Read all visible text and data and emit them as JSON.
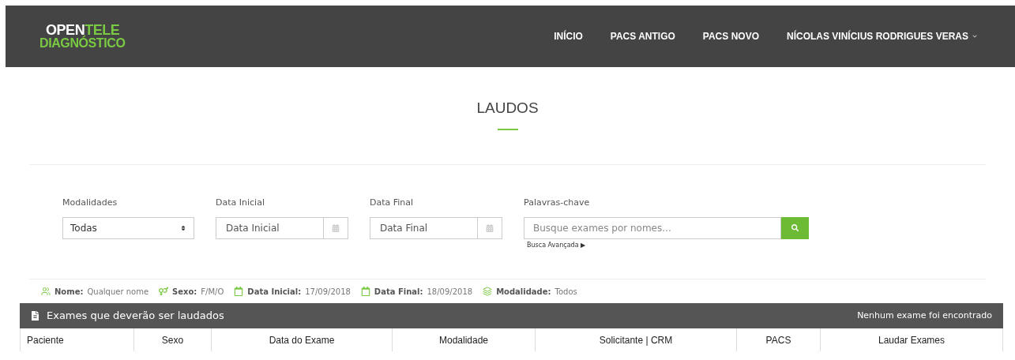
{
  "logo": {
    "line_1_white": "OPEN",
    "line_1_green": "TELE",
    "line_2": "DIAGNÓSTICO"
  },
  "nav": [
    "INÍCIO",
    "PACS ANTIGO",
    "PACS NOVO"
  ],
  "user_menu": "NÍCOLAS VINÍCIUS RODRIGUES VERAS",
  "page_title": "LAUDOS",
  "filters": {
    "modalidades": {
      "label": "Modalidades",
      "value": "Todas"
    },
    "data_inicial": {
      "label": "Data Inicial",
      "placeholder": "Data Inicial"
    },
    "data_final": {
      "label": "Data Final",
      "placeholder": "Data Final"
    },
    "palavras_chave": {
      "label": "Palavras-chave",
      "placeholder": "Busque exames por nomes..."
    },
    "advanced_search": "Busca Avançada ▶"
  },
  "summary": [
    {
      "label": "Nome:",
      "value": "Qualquer nome"
    },
    {
      "label": "Sexo:",
      "value": "F/M/O"
    },
    {
      "label": "Data Inicial:",
      "value": "17/09/2018"
    },
    {
      "label": "Data Final:",
      "value": "18/09/2018"
    },
    {
      "label": "Modalidade:",
      "value": "Todos"
    }
  ],
  "table": {
    "title": "Exames que deverão ser laudados",
    "status": "Nenhum exame foi encontrado",
    "columns": [
      "Paciente",
      "Sexo",
      "Data do Exame",
      "Modalidade",
      "Solicitante | CRM",
      "PACS",
      "Laudar Exames"
    ]
  }
}
